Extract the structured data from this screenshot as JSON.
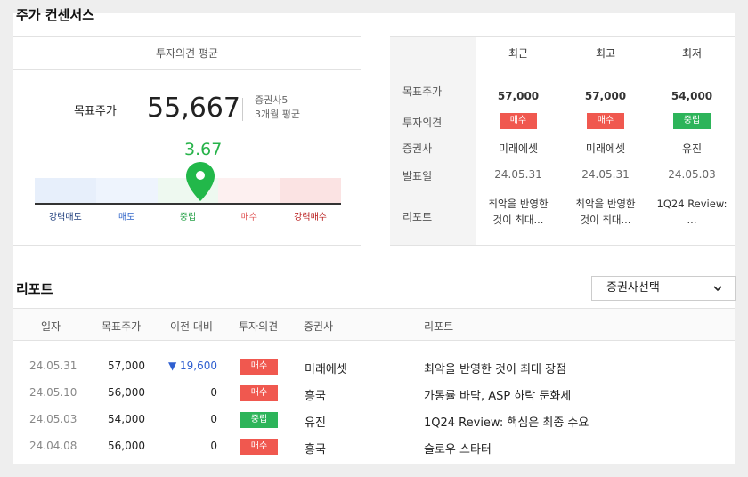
{
  "title": "주가 컨센서스",
  "summary": {
    "header": "투자의견 평균",
    "price_label": "목표주가",
    "price_value": "55,667",
    "meta_line1": "증권사5",
    "meta_line2": "3개월 평균",
    "score": "3.67",
    "bar": [
      {
        "label": "강력매도",
        "bg": "#e7effb",
        "text_color": "#1a3a7a"
      },
      {
        "label": "매도",
        "bg": "#eef4fd",
        "text_color": "#2f64c8"
      },
      {
        "label": "중립",
        "bg": "#eef9f0",
        "text_color": "#27a148"
      },
      {
        "label": "매수",
        "bg": "#fdf0f0",
        "text_color": "#e05555"
      },
      {
        "label": "강력매수",
        "bg": "#fbe3e3",
        "text_color": "#b81c1c"
      }
    ],
    "pin_color": "#22b84a"
  },
  "consensus_table": {
    "columns": [
      "최근",
      "최고",
      "최저"
    ],
    "row_labels": [
      "목표주가",
      "투자의견",
      "증권사",
      "발표일",
      "리포트"
    ],
    "cols": [
      {
        "price": "57,000",
        "opinion": "매수",
        "opinion_color": "#f0584f",
        "broker": "미래에셋",
        "date": "24.05.31",
        "report1": "최악을 반영한",
        "report2": "것이 최대..."
      },
      {
        "price": "57,000",
        "opinion": "매수",
        "opinion_color": "#f0584f",
        "broker": "미래에셋",
        "date": "24.05.31",
        "report1": "최악을 반영한",
        "report2": "것이 최대..."
      },
      {
        "price": "54,000",
        "opinion": "중립",
        "opinion_color": "#2db45a",
        "broker": "유진",
        "date": "24.05.03",
        "report1": "1Q24 Review:",
        "report2": "..."
      }
    ]
  },
  "reports": {
    "title": "리포트",
    "select_label": "증권사선택",
    "headers": [
      "일자",
      "목표주가",
      "이전 대비",
      "투자의견",
      "증권사",
      "리포트"
    ],
    "rows": [
      {
        "date": "24.05.31",
        "target": "57,000",
        "change": "▼ 19,600",
        "down": true,
        "opinion": "매수",
        "opinion_color": "#f0584f",
        "broker": "미래에셋",
        "report": "최악을 반영한 것이 최대 장점"
      },
      {
        "date": "24.05.10",
        "target": "56,000",
        "change": "0",
        "down": false,
        "opinion": "매수",
        "opinion_color": "#f0584f",
        "broker": "흥국",
        "report": "가동률 바닥, ASP 하락 둔화세"
      },
      {
        "date": "24.05.03",
        "target": "54,000",
        "change": "0",
        "down": false,
        "opinion": "중립",
        "opinion_color": "#2db45a",
        "broker": "유진",
        "report": "1Q24 Review: 핵심은 최종 수요"
      },
      {
        "date": "24.04.08",
        "target": "56,000",
        "change": "0",
        "down": false,
        "opinion": "매수",
        "opinion_color": "#f0584f",
        "broker": "흥국",
        "report": "슬로우 스타터"
      }
    ]
  }
}
